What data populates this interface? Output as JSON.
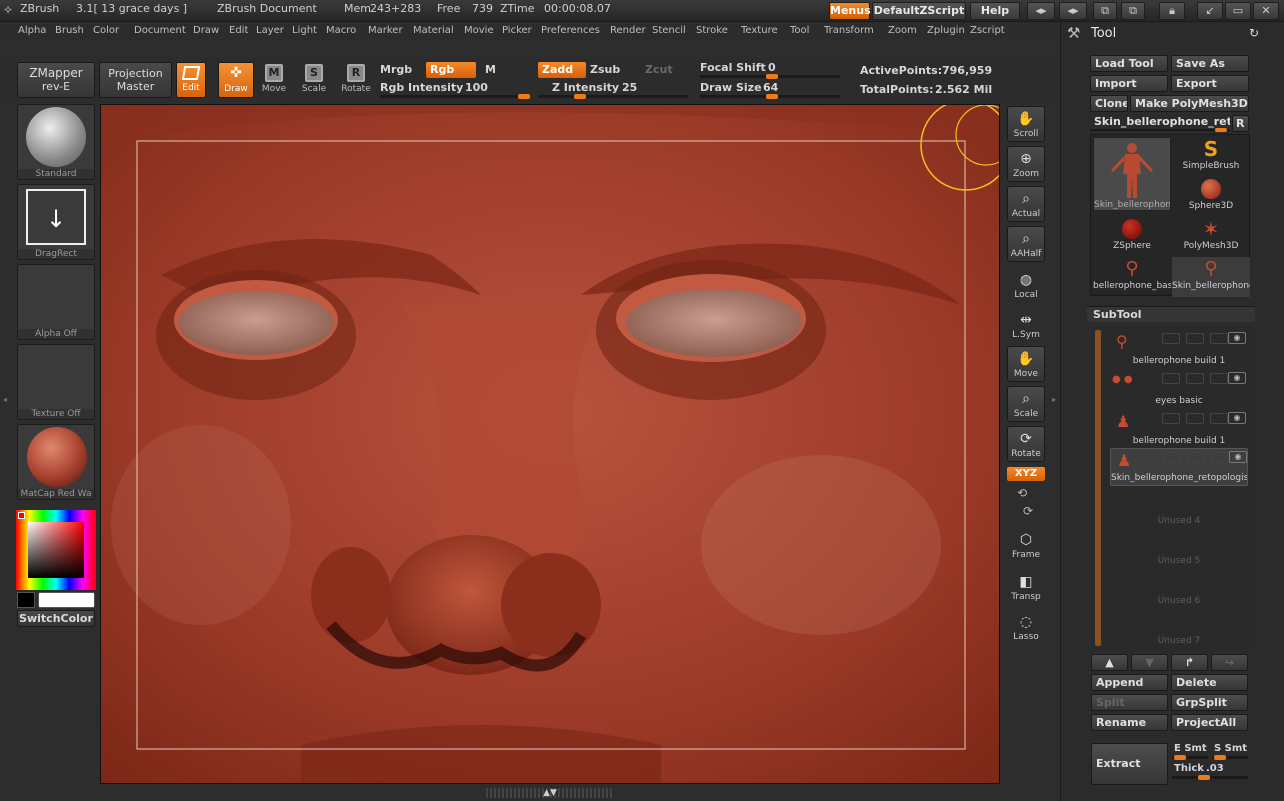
{
  "titlebar": {
    "app": "ZBrush",
    "version": "3.1[ 13 grace days ]",
    "document": "ZBrush Document",
    "mem_label": "Mem",
    "mem_value": "243+283",
    "free_label": "Free",
    "free_value": "739",
    "ztime_label": "ZTime",
    "ztime_value": "00:00:08.07",
    "menus_btn": "Menus",
    "script_btn": "DefaultZScript",
    "help_btn": "Help"
  },
  "menubar": [
    "Alpha",
    "Brush",
    "Color",
    "Document",
    "Draw",
    "Edit",
    "Layer",
    "Light",
    "Macro",
    "Marker",
    "Material",
    "Movie",
    "Picker",
    "Preferences",
    "Render",
    "Stencil",
    "Stroke",
    "Texture",
    "Tool",
    "Transform",
    "Zoom",
    "Zplugin",
    "Zscript"
  ],
  "toolbar": {
    "zmapper_l1": "ZMapper",
    "zmapper_l2": "rev-E",
    "projection_l1": "Projection",
    "projection_l2": "Master",
    "edit": "Edit",
    "draw": "Draw",
    "move": "Move",
    "scale": "Scale",
    "rotate": "Rotate",
    "mrgb": "Mrgb",
    "rgb": "Rgb",
    "m": "M",
    "rgb_intensity_label": "Rgb Intensity",
    "rgb_intensity_value": "100",
    "zadd": "Zadd",
    "zsub": "Zsub",
    "zcut": "Zcut",
    "z_intensity_label": "Z Intensity",
    "z_intensity_value": "25",
    "focal_label": "Focal Shift",
    "focal_value": "0",
    "drawsize_label": "Draw Size",
    "drawsize_value": "64",
    "active_label": "ActivePoints:",
    "active_value": "796,959",
    "total_label": "TotalPoints:",
    "total_value": "2.562 Mil"
  },
  "leftshelf": {
    "standard": "Standard",
    "dragrect": "DragRect",
    "alpha": "Alpha Off",
    "texture": "Texture Off",
    "matcap": "MatCap Red Wa",
    "switchcolor": "SwitchColor"
  },
  "rightshelf": [
    "Scroll",
    "Zoom",
    "Actual",
    "AAHalf",
    "Local",
    "L.Sym",
    "Move",
    "Scale",
    "Rotate",
    "Frame",
    "Transp",
    "Lasso"
  ],
  "xyz": "XYZ",
  "toolpanel": {
    "title": "Tool",
    "load_tool": "Load Tool",
    "save_as": "Save As",
    "import": "Import",
    "export": "Export",
    "clone": "Clone",
    "make_polymesh": "Make PolyMesh3D",
    "current_tool": "Skin_bellerophone_reto",
    "r": "R",
    "tools": [
      "Skin_bellerophone",
      "SimpleBrush",
      "Sphere3D",
      "ZSphere",
      "PolyMesh3D",
      "bellerophone_base",
      "Skin_bellerophone"
    ],
    "subtool_title": "SubTool",
    "subtools": [
      "bellerophone build 1",
      "eyes basic",
      "bellerophone build 1",
      "Skin_bellerophone_retopologise",
      "Unused 4",
      "Unused 5",
      "Unused 6",
      "Unused 7"
    ],
    "append": "Append",
    "delete": "Delete",
    "split": "Split",
    "grpsplit": "GrpSplit",
    "rename": "Rename",
    "projectall": "ProjectAll",
    "extract": "Extract",
    "e_smt": "E Smt",
    "s_smt": "S Smt",
    "thick_label": "Thick",
    "thick_value": ".03"
  },
  "colors": {
    "accent": "#f07a16",
    "clay": "#a8402e",
    "panel": "#2b2b2b"
  }
}
